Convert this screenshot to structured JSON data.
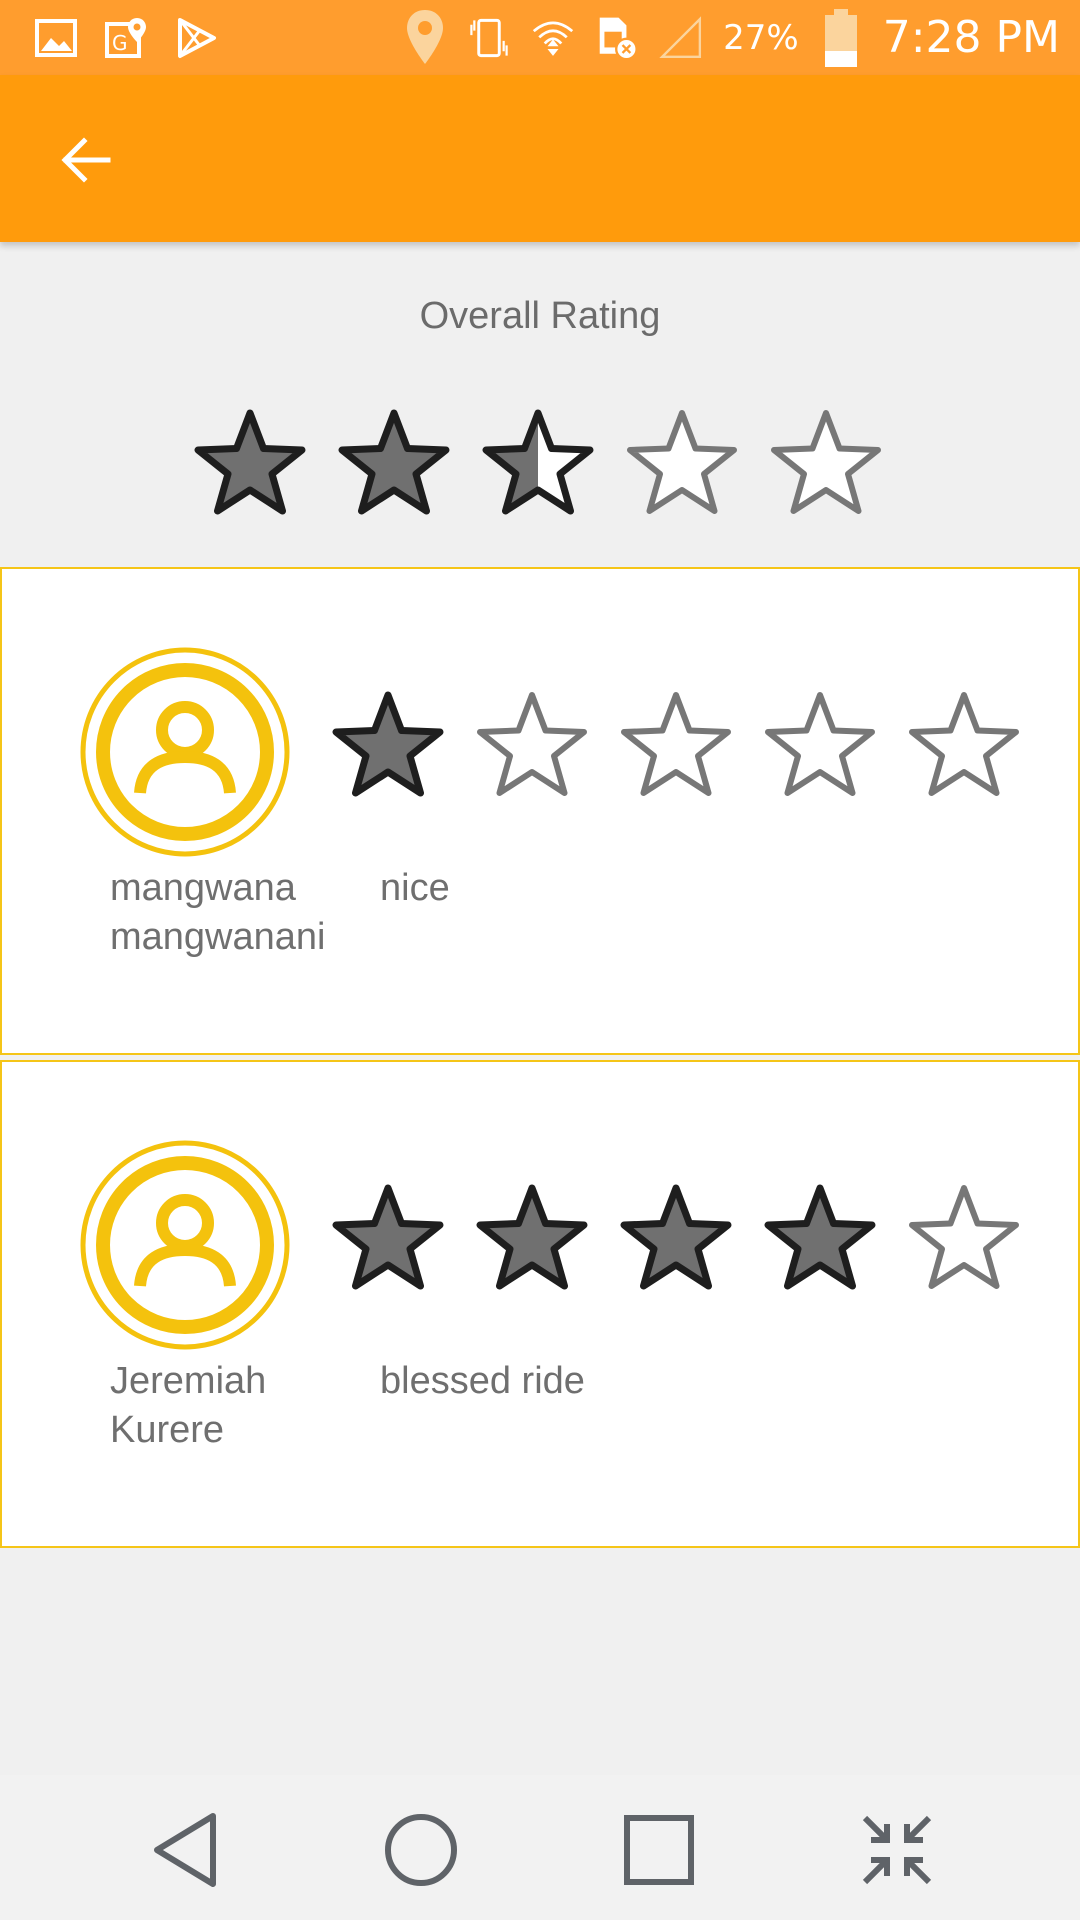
{
  "status_bar": {
    "icons_left": [
      "gallery-icon",
      "maps-icon",
      "play-store-icon"
    ],
    "icons_right": [
      "location-icon",
      "vibrate-icon",
      "wifi-icon",
      "sim-error-icon",
      "signal-icon",
      "battery-icon"
    ],
    "battery_percent": "27%",
    "time": "7:28 PM",
    "color": "#ff9d2e"
  },
  "app_bar": {
    "color": "#ff9b0c",
    "back_icon": "arrow-left-icon"
  },
  "overall": {
    "label": "Overall Rating",
    "rating": 2.5,
    "max": 5
  },
  "reviews": [
    {
      "name": "mangwana mangwanani",
      "comment": "nice",
      "rating": 1,
      "max": 5
    },
    {
      "name": "Jeremiah Kurere",
      "comment": "blessed ride",
      "rating": 4,
      "max": 5
    }
  ],
  "colors": {
    "accent_border": "#f5c518",
    "avatar_yellow": "#f4c20d",
    "star_fill": "#707070",
    "star_stroke_filled": "#1e1e1e",
    "star_stroke_empty": "#777777"
  },
  "nav_bar": {
    "icons": [
      "back-triangle-icon",
      "home-circle-icon",
      "recents-square-icon",
      "collapse-arrows-icon"
    ]
  }
}
